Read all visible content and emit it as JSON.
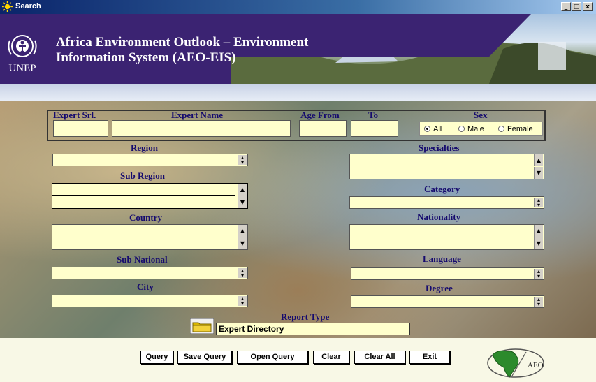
{
  "window": {
    "title": "Search",
    "minimize": "_",
    "restore": "□",
    "close": "x"
  },
  "header": {
    "title_line1": "Africa Environment Outlook – Environment",
    "title_line2": "Information System (AEO-EIS)",
    "org": "UNEP"
  },
  "form": {
    "expert_srl_label": "Expert Srl.",
    "expert_name_label": "Expert Name",
    "age_from_label": "Age From",
    "age_to_label": "To",
    "sex_label": "Sex",
    "sex_options": [
      "All",
      "Male",
      "Female"
    ],
    "region_label": "Region",
    "sub_region_label": "Sub Region",
    "country_label": "Country",
    "sub_national_label": "Sub National",
    "city_label": "City",
    "specialties_label": "Specialties",
    "category_label": "Category",
    "nationality_label": "Nationality",
    "language_label": "Language",
    "degree_label": "Degree",
    "report_type_label": "Report Type",
    "report_type_value": "Expert Directory"
  },
  "buttons": {
    "query": "Query",
    "save_query": "Save Query",
    "open_query": "Open Query",
    "clear": "Clear",
    "clear_all": "Clear All",
    "exit": "Exit"
  },
  "logo": {
    "aeo_text": "AEO"
  },
  "colors": {
    "label": "#150a6e",
    "field": "#ffffcc",
    "header_band": "#3b2372"
  }
}
